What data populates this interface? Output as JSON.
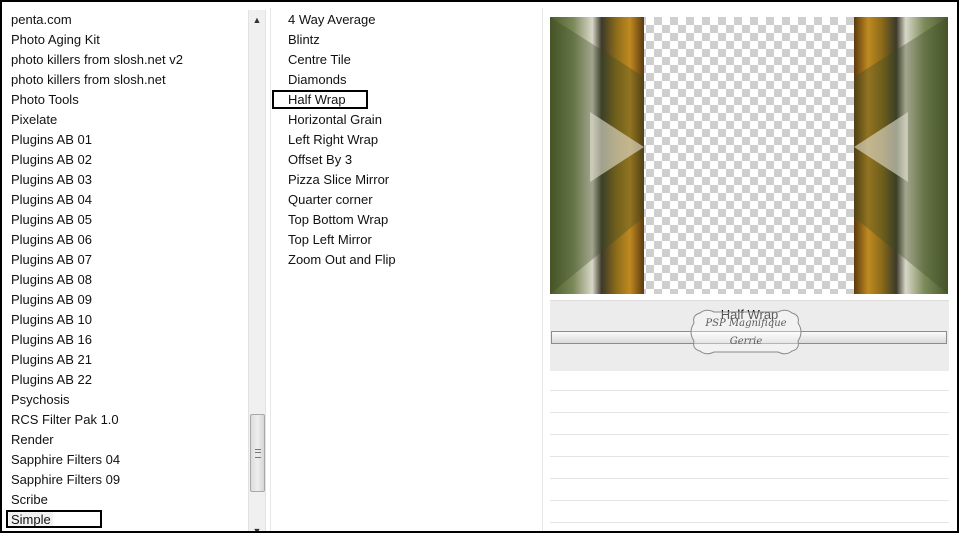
{
  "categories": [
    "penta.com",
    "Photo Aging Kit",
    "photo killers from slosh.net v2",
    "photo killers from slosh.net",
    "Photo Tools",
    "Pixelate",
    "Plugins AB 01",
    "Plugins AB 02",
    "Plugins AB 03",
    "Plugins AB 04",
    "Plugins AB 05",
    "Plugins AB 06",
    "Plugins AB 07",
    "Plugins AB 08",
    "Plugins AB 09",
    "Plugins AB 10",
    "Plugins AB 16",
    "Plugins AB 21",
    "Plugins AB 22",
    "Psychosis",
    "RCS Filter Pak 1.0",
    "Render",
    "Sapphire Filters 04",
    "Sapphire Filters 09",
    "Scribe",
    "Simple"
  ],
  "selected_category": "Simple",
  "filters": [
    "4 Way Average",
    "Blintz",
    "Centre Tile",
    "Diamonds",
    "Half Wrap",
    "Horizontal Grain",
    "Left Right Wrap",
    "Offset By 3",
    "Pizza Slice Mirror",
    "Quarter corner",
    "Top Bottom Wrap",
    "Top Left Mirror",
    "Zoom Out and Flip"
  ],
  "selected_filter": "Half Wrap",
  "preview": {
    "filter_name": "Half Wrap",
    "watermark_line1": "PSP Magnifique",
    "watermark_line2": "Gerrie"
  },
  "scrollbar": {
    "up_icon": "arrow-up-icon",
    "down_icon": "arrow-down-icon"
  }
}
